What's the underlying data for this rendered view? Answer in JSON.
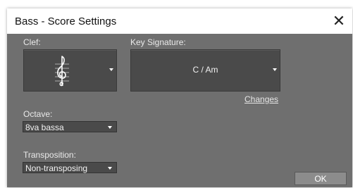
{
  "window": {
    "title": "Bass - Score Settings",
    "close_glyph": "✕"
  },
  "clef": {
    "label": "Clef:",
    "icon": "treble-clef-icon"
  },
  "key_signature": {
    "label": "Key Signature:",
    "value": "C / Am",
    "changes_link": "Changes"
  },
  "octave": {
    "label": "Octave:",
    "value": "8va bassa"
  },
  "transposition": {
    "label": "Transposition:",
    "value": "Non-transposing"
  },
  "buttons": {
    "ok": "OK"
  },
  "colors": {
    "panel": "#6f6f6f",
    "tile": "#4a4a4a",
    "text": "#e9e9e9"
  }
}
